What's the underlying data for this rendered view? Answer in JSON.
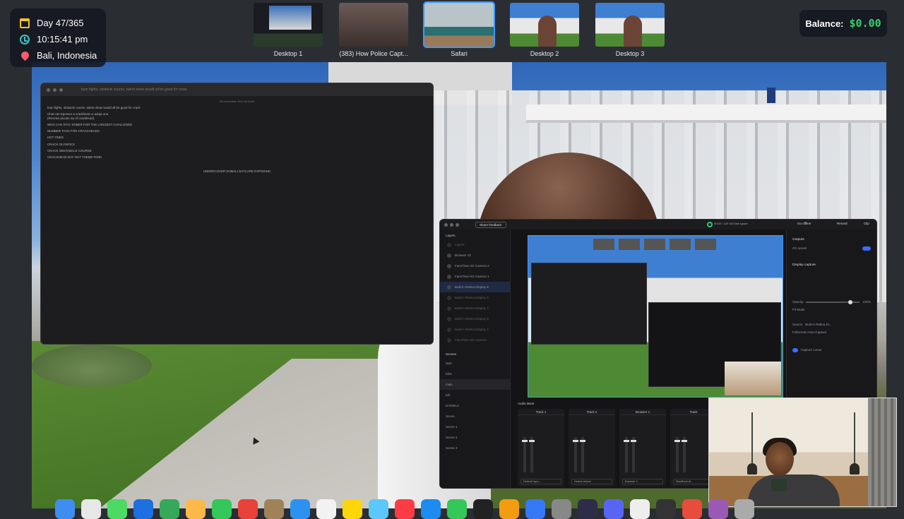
{
  "info": {
    "day": "Day 47/365",
    "time": "10:15:41 pm",
    "location": "Bali, Indonesia"
  },
  "spaces": [
    {
      "label": "Desktop 1",
      "selected": false
    },
    {
      "label": "(383) How Police Capt...",
      "selected": false
    },
    {
      "label": "Safari",
      "selected": true
    },
    {
      "label": "Desktop 2",
      "selected": false
    },
    {
      "label": "Desktop 3",
      "selected": false
    }
  ],
  "balance": {
    "label": "Balance:",
    "value": "$0.00"
  },
  "notes": {
    "title": "bum fights, obstacle course, talent show would all be good for crack",
    "date": "26 December 2024 at 04:54",
    "lines": [
      "bum fights, obstacle course, talent show would all be good for crack",
      "Chat can Sponsor a crackhead or adopt one\n(Receive picutre ivy of crackhead)",
      "WHO CAN STAY SOBER FOR THE LONGEST CHALLENGE",
      "NUMBER TAGS FOR CRACKHEADS",
      "HOT ONES",
      "CRACK OLYMPICS",
      "CRACK OBSTABCLE COURSE",
      "CRACKHEAD DAY OUT THEME PARK"
    ],
    "center_line": "UNDERCOVER SOMALI DAYCARE EXPOSING"
  },
  "stream": {
    "share_button": "Share feedback",
    "status": "00:00 / 229 GB  Disk space",
    "go_offline": "Go offline",
    "record": "Record",
    "clip": "Clip",
    "layers_header": "Layers",
    "layers": [
      {
        "name": "Layers",
        "on": false,
        "dim": true
      },
      {
        "name": "Browser 10",
        "on": false,
        "dim": false
      },
      {
        "name": "FaceTime HD Camera 2",
        "on": false,
        "dim": false
      },
      {
        "name": "FaceTime HD Camera 1",
        "on": false,
        "dim": false
      },
      {
        "name": "Built-in Retina Display 8",
        "on": true,
        "dim": false
      },
      {
        "name": "Built-in Retina Display 6",
        "on": false,
        "dim": true
      },
      {
        "name": "Built-in Retina Display 7",
        "on": false,
        "dim": true
      },
      {
        "name": "Built-in Retina Display 5",
        "on": false,
        "dim": true
      },
      {
        "name": "Built-in Retina Display 4",
        "on": false,
        "dim": true
      },
      {
        "name": "FaceTime HD Camera",
        "on": false,
        "dim": true
      }
    ],
    "scenes_header": "Scenes",
    "scenes": [
      {
        "name": "start",
        "on": false
      },
      {
        "name": "brbs",
        "on": false
      },
      {
        "name": "main",
        "on": true
      },
      {
        "name": "brb",
        "on": false
      },
      {
        "name": "DANIELA",
        "on": false
      },
      {
        "name": "Scene",
        "on": false
      },
      {
        "name": "Scene 1",
        "on": false
      },
      {
        "name": "Scene 2",
        "on": false
      },
      {
        "name": "Scene 3",
        "on": false
      }
    ],
    "outputs_header": "Outputs",
    "output_name": "OC server",
    "display_capture": "Display capture",
    "opacity_label": "Opacity",
    "opacity_value": "100%",
    "fit_mode": "Fit Mode",
    "source_label": "Source",
    "source_value": "Built-in Retina Di...",
    "fullscreen": "Fullscreen Auto-Capture",
    "capture_cursor": "Capture cursor",
    "audio_header": "Audio Mixer",
    "tracks": [
      {
        "name": "Track 1",
        "device": "Default Inpu..."
      },
      {
        "name": "Track 2",
        "device": "Select device"
      },
      {
        "name": "Browser 1",
        "device": "Browser 1"
      },
      {
        "name": "Track",
        "device": "MacBook Ai..."
      },
      {
        "name": "Track 2",
        "device": "Default Inpu..."
      }
    ]
  },
  "colors": {
    "balance_value": "#3ad16a",
    "selection_blue": "#3b9bff"
  }
}
